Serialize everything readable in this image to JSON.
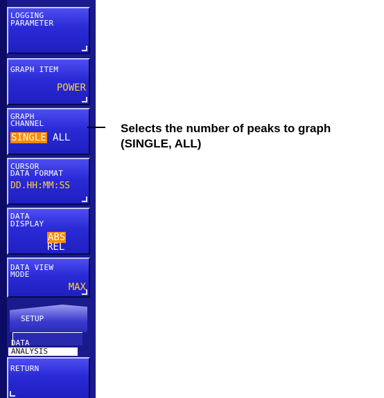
{
  "keys": {
    "logging_parameter": {
      "line1": "LOGGING",
      "line2": "PARAMETER"
    },
    "graph_item": {
      "label": "GRAPH ITEM",
      "value": "POWER"
    },
    "graph_channel": {
      "line1": "GRAPH",
      "line2": "CHANNEL",
      "opt_selected": "SINGLE",
      "opt_other": "ALL"
    },
    "cursor_data_format": {
      "line1": "CURSOR",
      "line2": "DATA FORMAT",
      "value": "DD.HH:MM:SS"
    },
    "data_display": {
      "line1": "DATA",
      "line2": "DISPLAY",
      "opt_selected": "ABS",
      "opt_other": "REL"
    },
    "data_view_mode": {
      "line1": "DATA VIEW",
      "line2": "MODE",
      "value": "MAX"
    },
    "setup": {
      "tab_label": "SETUP",
      "line1": "DATA",
      "line2": "ANALYSIS"
    },
    "return": {
      "label": "RETURN"
    }
  },
  "callout": {
    "line1": "Selects the number of peaks to graph",
    "line2": "(SINGLE, ALL)"
  },
  "colors": {
    "panel": "#1a1a8c",
    "key": "#2a2ad6",
    "value": "#ffd23c",
    "highlight": "#ff8a00"
  }
}
